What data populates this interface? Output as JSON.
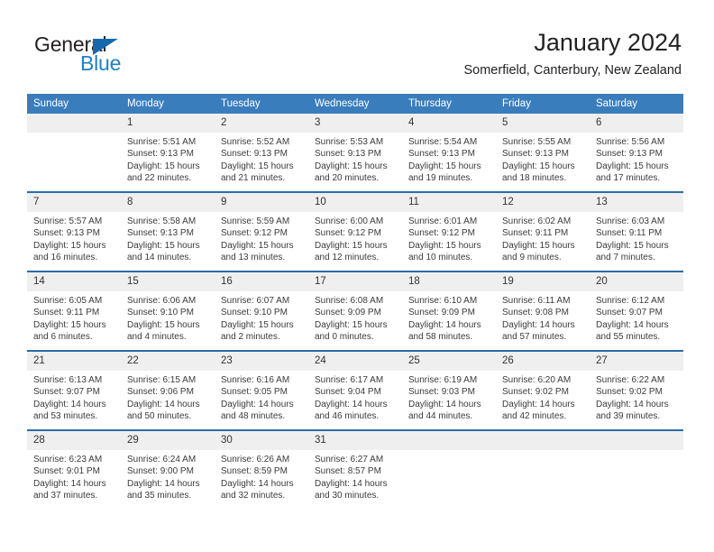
{
  "branding": {
    "name_part1": "General",
    "name_part2": "Blue",
    "triangle_color": "#1668ad",
    "blue_color": "#1f7fc4"
  },
  "header": {
    "title": "January 2024",
    "subtitle": "Somerfield, Canterbury, New Zealand"
  },
  "theme": {
    "header_row_color": "#3a7dbd",
    "divider_color": "#2c6ca8",
    "daynum_band_color": "#efefef"
  },
  "weekdays": [
    "Sunday",
    "Monday",
    "Tuesday",
    "Wednesday",
    "Thursday",
    "Friday",
    "Saturday"
  ],
  "weeks": [
    [
      {
        "day": "",
        "sunrise": "",
        "sunset": "",
        "daylight1": "",
        "daylight2": ""
      },
      {
        "day": "1",
        "sunrise": "Sunrise: 5:51 AM",
        "sunset": "Sunset: 9:13 PM",
        "daylight1": "Daylight: 15 hours",
        "daylight2": "and 22 minutes."
      },
      {
        "day": "2",
        "sunrise": "Sunrise: 5:52 AM",
        "sunset": "Sunset: 9:13 PM",
        "daylight1": "Daylight: 15 hours",
        "daylight2": "and 21 minutes."
      },
      {
        "day": "3",
        "sunrise": "Sunrise: 5:53 AM",
        "sunset": "Sunset: 9:13 PM",
        "daylight1": "Daylight: 15 hours",
        "daylight2": "and 20 minutes."
      },
      {
        "day": "4",
        "sunrise": "Sunrise: 5:54 AM",
        "sunset": "Sunset: 9:13 PM",
        "daylight1": "Daylight: 15 hours",
        "daylight2": "and 19 minutes."
      },
      {
        "day": "5",
        "sunrise": "Sunrise: 5:55 AM",
        "sunset": "Sunset: 9:13 PM",
        "daylight1": "Daylight: 15 hours",
        "daylight2": "and 18 minutes."
      },
      {
        "day": "6",
        "sunrise": "Sunrise: 5:56 AM",
        "sunset": "Sunset: 9:13 PM",
        "daylight1": "Daylight: 15 hours",
        "daylight2": "and 17 minutes."
      }
    ],
    [
      {
        "day": "7",
        "sunrise": "Sunrise: 5:57 AM",
        "sunset": "Sunset: 9:13 PM",
        "daylight1": "Daylight: 15 hours",
        "daylight2": "and 16 minutes."
      },
      {
        "day": "8",
        "sunrise": "Sunrise: 5:58 AM",
        "sunset": "Sunset: 9:13 PM",
        "daylight1": "Daylight: 15 hours",
        "daylight2": "and 14 minutes."
      },
      {
        "day": "9",
        "sunrise": "Sunrise: 5:59 AM",
        "sunset": "Sunset: 9:12 PM",
        "daylight1": "Daylight: 15 hours",
        "daylight2": "and 13 minutes."
      },
      {
        "day": "10",
        "sunrise": "Sunrise: 6:00 AM",
        "sunset": "Sunset: 9:12 PM",
        "daylight1": "Daylight: 15 hours",
        "daylight2": "and 12 minutes."
      },
      {
        "day": "11",
        "sunrise": "Sunrise: 6:01 AM",
        "sunset": "Sunset: 9:12 PM",
        "daylight1": "Daylight: 15 hours",
        "daylight2": "and 10 minutes."
      },
      {
        "day": "12",
        "sunrise": "Sunrise: 6:02 AM",
        "sunset": "Sunset: 9:11 PM",
        "daylight1": "Daylight: 15 hours",
        "daylight2": "and 9 minutes."
      },
      {
        "day": "13",
        "sunrise": "Sunrise: 6:03 AM",
        "sunset": "Sunset: 9:11 PM",
        "daylight1": "Daylight: 15 hours",
        "daylight2": "and 7 minutes."
      }
    ],
    [
      {
        "day": "14",
        "sunrise": "Sunrise: 6:05 AM",
        "sunset": "Sunset: 9:11 PM",
        "daylight1": "Daylight: 15 hours",
        "daylight2": "and 6 minutes."
      },
      {
        "day": "15",
        "sunrise": "Sunrise: 6:06 AM",
        "sunset": "Sunset: 9:10 PM",
        "daylight1": "Daylight: 15 hours",
        "daylight2": "and 4 minutes."
      },
      {
        "day": "16",
        "sunrise": "Sunrise: 6:07 AM",
        "sunset": "Sunset: 9:10 PM",
        "daylight1": "Daylight: 15 hours",
        "daylight2": "and 2 minutes."
      },
      {
        "day": "17",
        "sunrise": "Sunrise: 6:08 AM",
        "sunset": "Sunset: 9:09 PM",
        "daylight1": "Daylight: 15 hours",
        "daylight2": "and 0 minutes."
      },
      {
        "day": "18",
        "sunrise": "Sunrise: 6:10 AM",
        "sunset": "Sunset: 9:09 PM",
        "daylight1": "Daylight: 14 hours",
        "daylight2": "and 58 minutes."
      },
      {
        "day": "19",
        "sunrise": "Sunrise: 6:11 AM",
        "sunset": "Sunset: 9:08 PM",
        "daylight1": "Daylight: 14 hours",
        "daylight2": "and 57 minutes."
      },
      {
        "day": "20",
        "sunrise": "Sunrise: 6:12 AM",
        "sunset": "Sunset: 9:07 PM",
        "daylight1": "Daylight: 14 hours",
        "daylight2": "and 55 minutes."
      }
    ],
    [
      {
        "day": "21",
        "sunrise": "Sunrise: 6:13 AM",
        "sunset": "Sunset: 9:07 PM",
        "daylight1": "Daylight: 14 hours",
        "daylight2": "and 53 minutes."
      },
      {
        "day": "22",
        "sunrise": "Sunrise: 6:15 AM",
        "sunset": "Sunset: 9:06 PM",
        "daylight1": "Daylight: 14 hours",
        "daylight2": "and 50 minutes."
      },
      {
        "day": "23",
        "sunrise": "Sunrise: 6:16 AM",
        "sunset": "Sunset: 9:05 PM",
        "daylight1": "Daylight: 14 hours",
        "daylight2": "and 48 minutes."
      },
      {
        "day": "24",
        "sunrise": "Sunrise: 6:17 AM",
        "sunset": "Sunset: 9:04 PM",
        "daylight1": "Daylight: 14 hours",
        "daylight2": "and 46 minutes."
      },
      {
        "day": "25",
        "sunrise": "Sunrise: 6:19 AM",
        "sunset": "Sunset: 9:03 PM",
        "daylight1": "Daylight: 14 hours",
        "daylight2": "and 44 minutes."
      },
      {
        "day": "26",
        "sunrise": "Sunrise: 6:20 AM",
        "sunset": "Sunset: 9:02 PM",
        "daylight1": "Daylight: 14 hours",
        "daylight2": "and 42 minutes."
      },
      {
        "day": "27",
        "sunrise": "Sunrise: 6:22 AM",
        "sunset": "Sunset: 9:02 PM",
        "daylight1": "Daylight: 14 hours",
        "daylight2": "and 39 minutes."
      }
    ],
    [
      {
        "day": "28",
        "sunrise": "Sunrise: 6:23 AM",
        "sunset": "Sunset: 9:01 PM",
        "daylight1": "Daylight: 14 hours",
        "daylight2": "and 37 minutes."
      },
      {
        "day": "29",
        "sunrise": "Sunrise: 6:24 AM",
        "sunset": "Sunset: 9:00 PM",
        "daylight1": "Daylight: 14 hours",
        "daylight2": "and 35 minutes."
      },
      {
        "day": "30",
        "sunrise": "Sunrise: 6:26 AM",
        "sunset": "Sunset: 8:59 PM",
        "daylight1": "Daylight: 14 hours",
        "daylight2": "and 32 minutes."
      },
      {
        "day": "31",
        "sunrise": "Sunrise: 6:27 AM",
        "sunset": "Sunset: 8:57 PM",
        "daylight1": "Daylight: 14 hours",
        "daylight2": "and 30 minutes."
      },
      {
        "day": "",
        "sunrise": "",
        "sunset": "",
        "daylight1": "",
        "daylight2": ""
      },
      {
        "day": "",
        "sunrise": "",
        "sunset": "",
        "daylight1": "",
        "daylight2": ""
      },
      {
        "day": "",
        "sunrise": "",
        "sunset": "",
        "daylight1": "",
        "daylight2": ""
      }
    ]
  ]
}
